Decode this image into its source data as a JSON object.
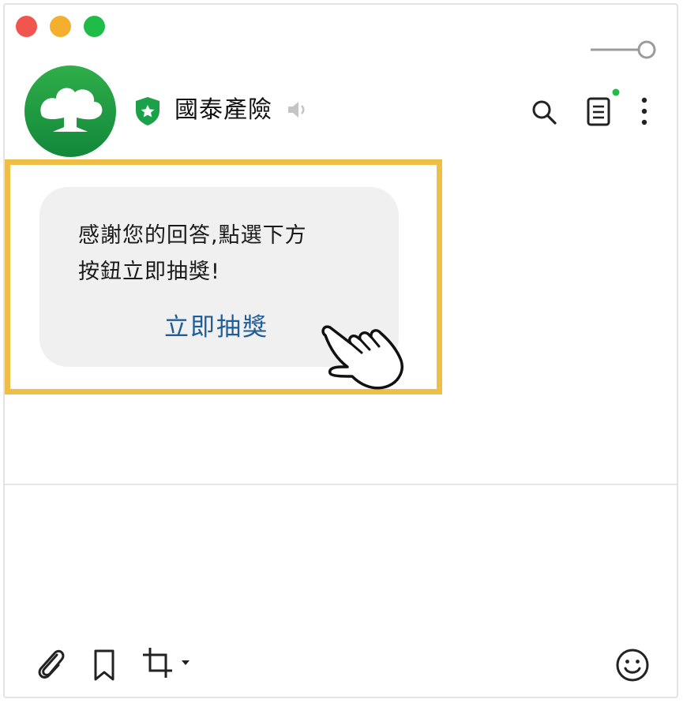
{
  "window": {
    "controls": [
      "close",
      "minimize",
      "zoom"
    ]
  },
  "header": {
    "title": "國泰產險",
    "icons": [
      "official-account-shield-icon",
      "mute-icon",
      "search-icon",
      "notes-icon",
      "more-icon"
    ],
    "notes_has_notification": true
  },
  "message": {
    "lines": [
      "感謝您的回答,點選下方",
      "按鈕立即抽獎!"
    ],
    "action_label": "立即抽獎"
  },
  "composer": {
    "icons": [
      "paperclip-icon",
      "bookmark-icon",
      "crop-icon",
      "emoji-icon"
    ]
  },
  "colors": {
    "brand_green": "#1a9e3a",
    "highlight": "#efbe47",
    "link_blue": "#1f5d97",
    "bubble_bg": "#f0f0f0"
  }
}
